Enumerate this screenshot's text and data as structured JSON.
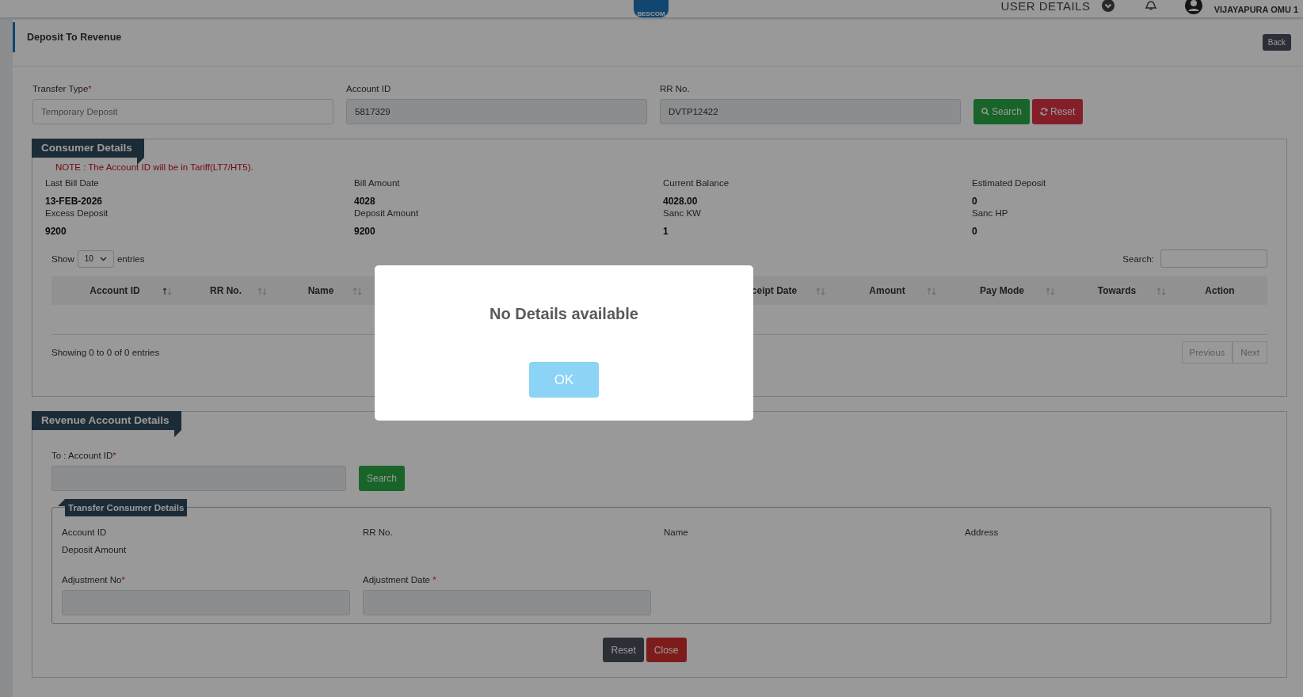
{
  "header": {
    "logo_text": "BESCOM",
    "user_menu": "USER DETAILS",
    "user_name": "VIJAYAPURA OMU 1"
  },
  "page": {
    "title": "Deposit To Revenue",
    "back_button": "Back"
  },
  "search_form": {
    "fields": [
      {
        "label": "Transfer Type",
        "required_mark": "*",
        "placeholder": "Temporary Deposit",
        "readonly": false
      },
      {
        "label": "Account ID",
        "value": "5817329",
        "readonly": true
      },
      {
        "label": "RR No.",
        "value": "DVTP12422",
        "readonly": true
      }
    ],
    "buttons": [
      {
        "kind": "search",
        "label": "Search"
      },
      {
        "kind": "reset",
        "label": "Reset"
      }
    ]
  },
  "consumer_details": {
    "legend": "Consumer Details",
    "note": "NOTE : The Account ID will be in Tariff(LT7/HT5).",
    "info": [
      {
        "label": "Last Bill Date",
        "value": "13-FEB-2026"
      },
      {
        "label": "Bill Amount",
        "value": "4028"
      },
      {
        "label": "Current Balance",
        "value": "4028.00"
      },
      {
        "label": "Estimated Deposit",
        "value": "0"
      },
      {
        "label": "Excess Deposit",
        "value": "9200"
      },
      {
        "label": "Deposit Amount",
        "value": "9200"
      },
      {
        "label": "Sanc KW",
        "value": "1"
      },
      {
        "label": "Sanc HP",
        "value": "0"
      }
    ],
    "table": {
      "show_label": "Show",
      "page_length": "10",
      "entries_label": "entries",
      "search_label": "Search:",
      "columns": [
        {
          "label": "Account ID",
          "sorted": true
        },
        {
          "label": "RR No.",
          "sorted": false
        },
        {
          "label": "Name",
          "sorted": false
        },
        {
          "label": "ceipt Date",
          "sorted": false
        },
        {
          "label": "Amount",
          "sorted": false
        },
        {
          "label": "Pay Mode",
          "sorted": false
        },
        {
          "label": "Towards",
          "sorted": false
        },
        {
          "label": "Action"
        }
      ],
      "info": "Showing 0 to 0 of 0 entries",
      "pager": [
        {
          "label": "Previous",
          "disabled": true
        },
        {
          "label": "Next",
          "disabled": true
        }
      ]
    }
  },
  "revenue_account": {
    "legend": "Revenue Account Details",
    "to_account": {
      "label": "To : Account ID",
      "required_mark": "*"
    },
    "search_button": "Search",
    "transfer": {
      "legend": "Transfer Consumer Details",
      "info_labels": [
        "Account ID",
        "RR No.",
        "Name",
        "Address",
        "Deposit Amount"
      ],
      "fields": [
        {
          "label": "Adjustment No",
          "required_mark": "*"
        },
        {
          "label": "Adjustment Date",
          "required_mark": " *"
        }
      ]
    },
    "buttons": [
      {
        "kind": "reset",
        "label": "Reset"
      },
      {
        "kind": "close",
        "label": "Close"
      }
    ]
  },
  "dialog": {
    "message": "No Details available",
    "button": "OK"
  }
}
